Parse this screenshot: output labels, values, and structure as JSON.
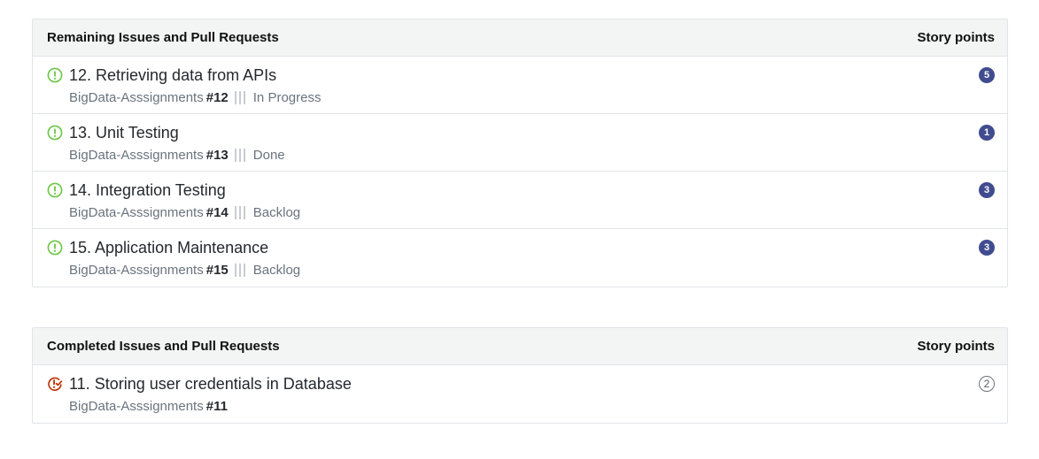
{
  "remaining": {
    "header": "Remaining Issues and Pull Requests",
    "points_header": "Story points",
    "items": [
      {
        "title": "12. Retrieving data from APIs",
        "repo": "BigData-Asssignments",
        "number": "#12",
        "status": "In Progress",
        "points": "5"
      },
      {
        "title": "13. Unit Testing",
        "repo": "BigData-Asssignments",
        "number": "#13",
        "status": "Done",
        "points": "1"
      },
      {
        "title": "14. Integration Testing",
        "repo": "BigData-Asssignments",
        "number": "#14",
        "status": "Backlog",
        "points": "3"
      },
      {
        "title": "15. Application Maintenance",
        "repo": "BigData-Asssignments",
        "number": "#15",
        "status": "Backlog",
        "points": "3"
      }
    ]
  },
  "completed": {
    "header": "Completed Issues and Pull Requests",
    "points_header": "Story points",
    "items": [
      {
        "title": "11. Storing user credentials in Database",
        "repo": "BigData-Asssignments",
        "number": "#11",
        "points": "2"
      }
    ]
  },
  "colors": {
    "open_issue_icon": "#6cc644",
    "closed_issue_icon": "#bd2c00",
    "points_badge": "#414c8f"
  },
  "icons": {
    "open": "issue-opened-icon",
    "closed": "issue-closed-icon"
  }
}
